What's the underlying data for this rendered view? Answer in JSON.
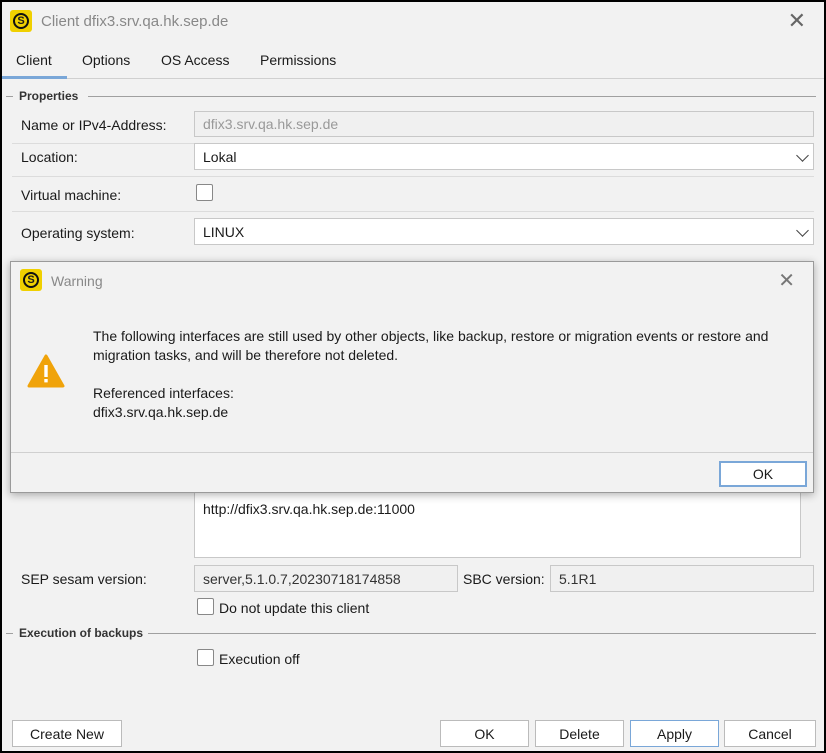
{
  "window": {
    "title": "Client dfix3.srv.qa.hk.sep.de"
  },
  "tabs": [
    {
      "label": "Client",
      "active": true
    },
    {
      "label": "Options"
    },
    {
      "label": "OS Access"
    },
    {
      "label": "Permissions"
    }
  ],
  "properties": {
    "section": "Properties",
    "name_label": "Name or IPv4-Address:",
    "name_value": "dfix3.srv.qa.hk.sep.de",
    "location_label": "Location:",
    "location_value": "Lokal",
    "vm_label": "Virtual machine:",
    "vm_checked": false,
    "os_label": "Operating system:",
    "os_value": "LINUX",
    "interfaces_visible_line": "http://dfix3.srv.qa.hk.sep.de:11000",
    "sesam_label": "SEP sesam version:",
    "sesam_value": "server,5.1.0.7,20230718174858",
    "sbc_label": "SBC version:",
    "sbc_value": "5.1R1",
    "no_update_label": "Do not update this client",
    "no_update_checked": false
  },
  "execution": {
    "section": "Execution of backups",
    "execution_off_label": "Execution off",
    "execution_off_checked": false
  },
  "footer": {
    "create_new": "Create New",
    "ok": "OK",
    "delete": "Delete",
    "apply": "Apply",
    "cancel": "Cancel"
  },
  "warning": {
    "title": "Warning",
    "message": "The following interfaces are still used by other objects, like backup, restore or migration events or restore and migration tasks, and will be therefore not deleted.",
    "ref_label": "Referenced interfaces:",
    "ref_value": "dfix3.srv.qa.hk.sep.de",
    "ok": "OK"
  },
  "colors": {
    "accent": "#7aa7d8",
    "logo": "#f0d000",
    "warning": "#f0a30a"
  }
}
